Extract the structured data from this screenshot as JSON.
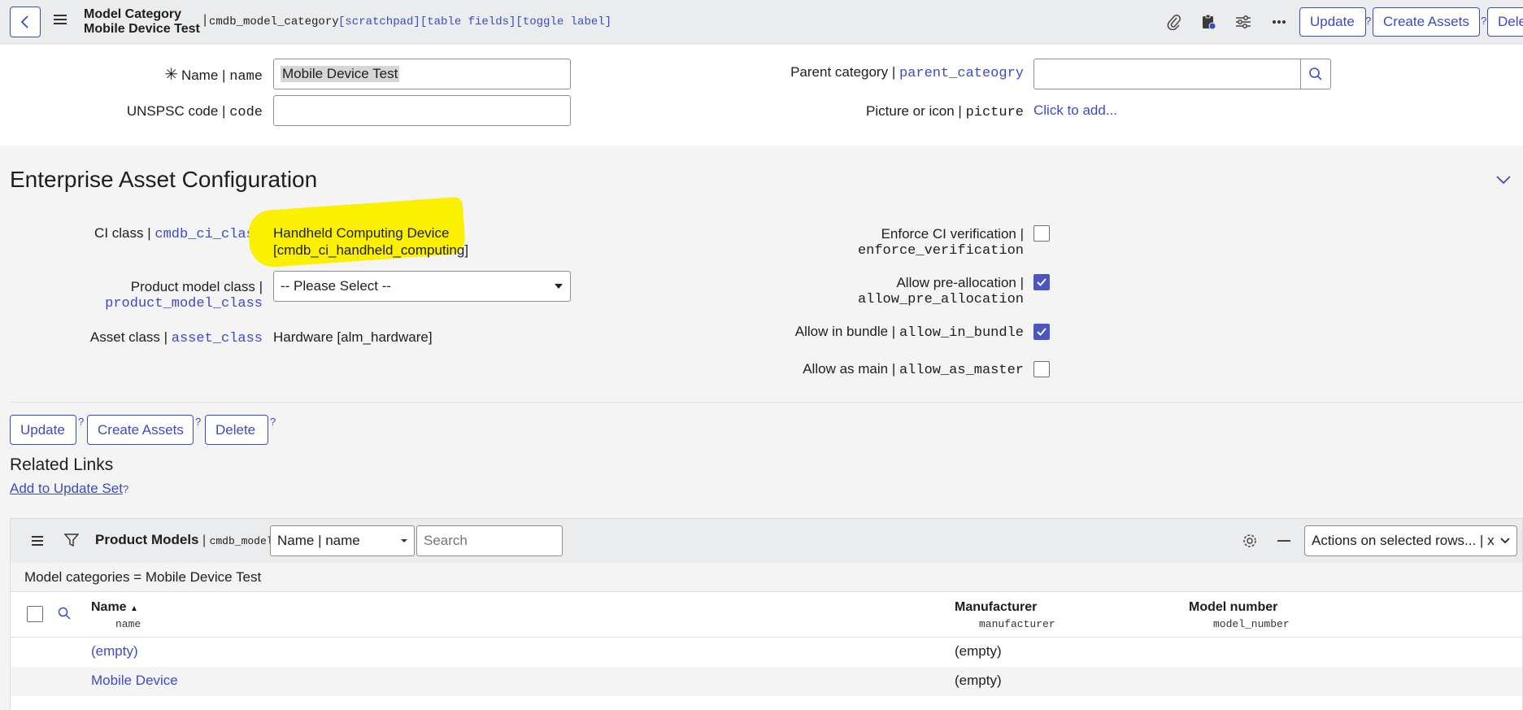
{
  "header": {
    "title_line1": "Model Category",
    "title_line2": "Mobile Device Test",
    "separator": "|",
    "table_name": "cmdb_model_category",
    "links": "[scratchpad][table fields][toggle label]",
    "buttons": {
      "update": "Update",
      "create_assets": "Create Assets",
      "delete": "Dele"
    },
    "help": "?"
  },
  "form": {
    "name_label": "Name |",
    "name_field": "name",
    "name_value": "Mobile Device Test",
    "unspsc_label": "UNSPSC code |",
    "unspsc_field": "code",
    "unspsc_value": "",
    "parent_label": "Parent category |",
    "parent_field": "parent_cateogry",
    "parent_value": "",
    "picture_label": "Picture or icon |",
    "picture_field": "picture",
    "picture_link": "Click to add..."
  },
  "eac": {
    "title": "Enterprise Asset Configuration",
    "ci_class_label": "CI class |",
    "ci_class_field": "cmdb_ci_class",
    "ci_class_value_line1": "Handheld Computing Device",
    "ci_class_value_line2": "[cmdb_ci_handheld_computing]",
    "product_model_label": "Product model class |",
    "product_model_field": "product_model_class",
    "product_model_value": "-- Please Select --",
    "asset_class_label": "Asset class |",
    "asset_class_field": "asset_class",
    "asset_class_value": "Hardware [alm_hardware]",
    "enforce_label": "Enforce CI verification |",
    "enforce_field": "enforce_verification",
    "enforce_checked": false,
    "prealloc_label": "Allow pre-allocation |",
    "prealloc_field": "allow_pre_allocation",
    "prealloc_checked": true,
    "bundle_label": "Allow in bundle |",
    "bundle_field": "allow_in_bundle",
    "bundle_checked": true,
    "main_label": "Allow as main |",
    "main_field": "allow_as_master",
    "main_checked": false
  },
  "buttons": {
    "update": "Update",
    "create_assets": "Create Assets",
    "delete": "Delete",
    "help": "?"
  },
  "related_links": {
    "title": "Related Links",
    "add_to_update_set": "Add to Update Set",
    "help": "?"
  },
  "related_list": {
    "title": "Product Models",
    "table": "cmdb_model",
    "search_field": "Name | name",
    "search_placeholder": "Search",
    "actions": "Actions on selected rows... | x",
    "filter": "Model categories = Mobile Device Test",
    "columns": [
      {
        "label": "Name",
        "field": "name",
        "sort": "▲"
      },
      {
        "label": "Manufacturer",
        "field": "manufacturer"
      },
      {
        "label": "Model number",
        "field": "model_number"
      }
    ],
    "rows": [
      {
        "name": "(empty)",
        "manufacturer": "(empty)",
        "model_number": ""
      },
      {
        "name": "Mobile Device",
        "manufacturer": "(empty)",
        "model_number": ""
      }
    ]
  },
  "colors": {
    "accent": "#3c4bc5",
    "highlight": "#fbf000",
    "checkbox": "#4b55c4"
  }
}
